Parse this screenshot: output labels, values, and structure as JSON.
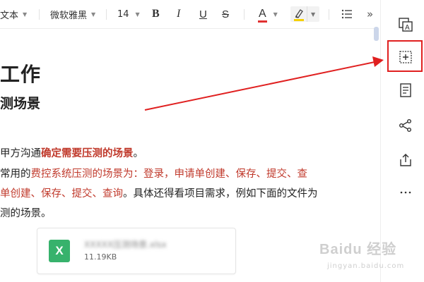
{
  "toolbar": {
    "style_label": "文本",
    "font_label": "微软雅黑",
    "size_label": "14",
    "bold": "B",
    "italic": "I",
    "underline": "U",
    "strike": "S",
    "font_color": "A",
    "more": "»"
  },
  "doc": {
    "h1": "工作",
    "h2": "测场景",
    "line1_pre": "甲方沟通",
    "line1_bold": "确定需要压测的场景",
    "line1_post": "。",
    "line2_pre": "常用的",
    "line2_red": "费控系统压测的场景为：登录，申请单创建、保存、提交、查",
    "line3_red": "单创建、保存、提交、查询",
    "line3_post": "。具体还得看项目需求，例如下面的文件为",
    "line4": "测的场景。",
    "file": {
      "type_letter": "X",
      "name": "XXXXX压测场景.xlsx",
      "size": "11.19KB"
    }
  },
  "watermark": {
    "brand": "Baidu 经验",
    "sub": "jingyan.baidu.com"
  },
  "colors": {
    "accent_red": "#e02020",
    "text_red": "#c0392b",
    "excel_green": "#37b26c",
    "highlight_yellow": "#f5d000"
  },
  "icons": [
    "caret-down-icon",
    "highlighter-icon",
    "list-icon",
    "more-icon",
    "format-panel-icon",
    "insert-icon",
    "outline-icon",
    "share-icon",
    "export-icon",
    "more-dots-icon",
    "excel-file-icon"
  ]
}
